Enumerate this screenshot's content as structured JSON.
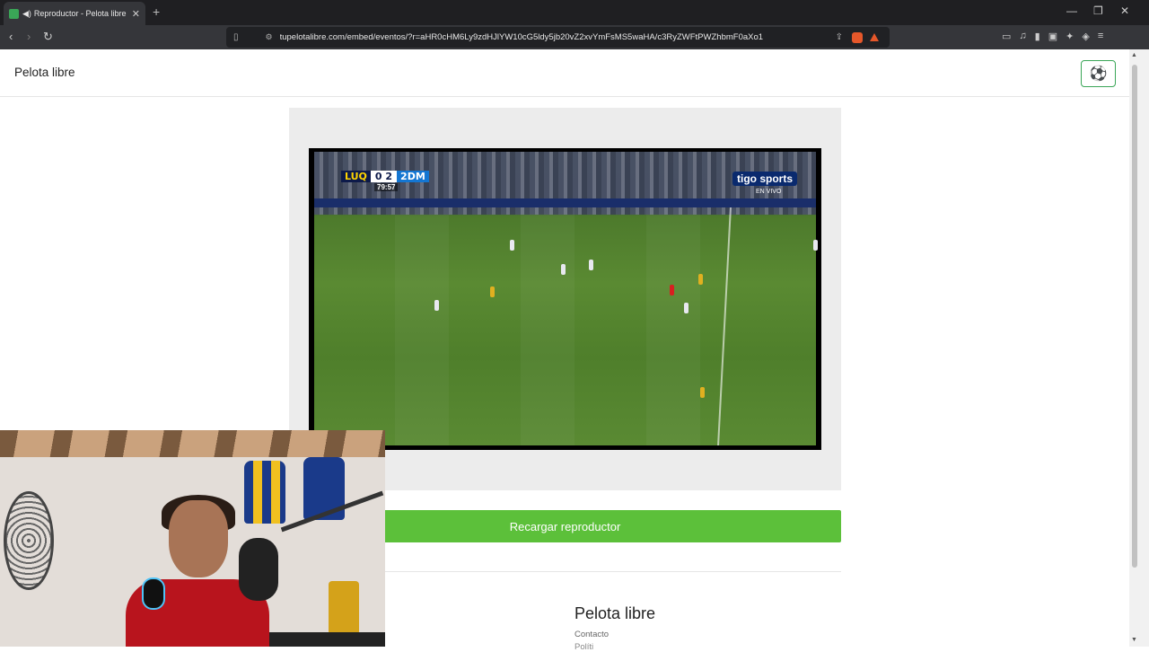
{
  "browser": {
    "tab_title": "Reproductor - Pelota libre",
    "tab_close": "✕",
    "new_tab": "+",
    "url": "tupelotalibre.com/embed/eventos/?r=aHR0cHM6Ly9zdHJlYW10cG5ldy5jb20vZ2xvYmFsMS5waHA/c3RyZWFtPWZhbmF0aXo1"
  },
  "site": {
    "brand": "Pelota libre",
    "reload_button": "Recargar reproductor",
    "footer_title": "Pelota libre",
    "footer_link": "Contacto",
    "footer_link2": "Políti"
  },
  "video": {
    "home_team": "LUQ",
    "score": "0 2",
    "away_team": "2DM",
    "clock": "79:57",
    "broadcaster": "tigo sports",
    "live_label": "EN VIVO"
  }
}
